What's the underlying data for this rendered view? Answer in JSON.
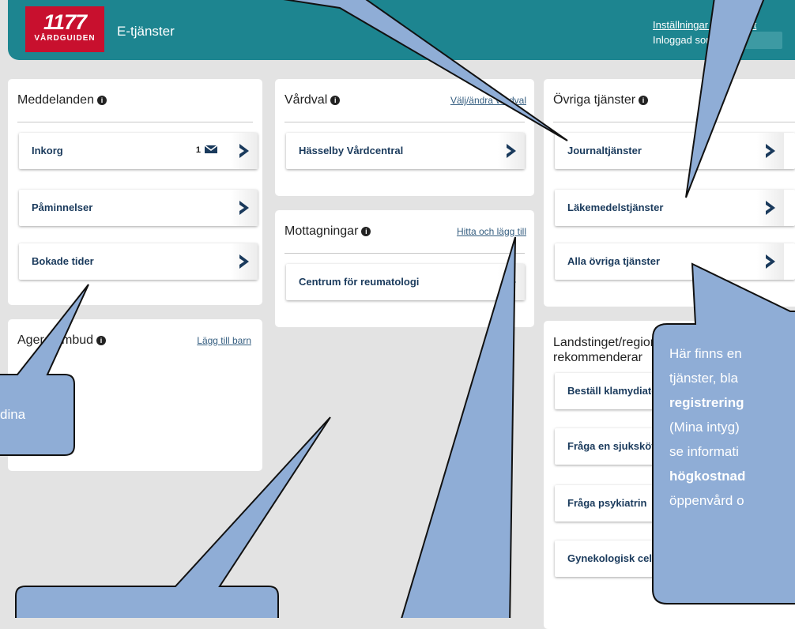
{
  "header": {
    "logo_number": "1177",
    "logo_text": "VÅRDGUIDEN",
    "title": "E-tjänster",
    "link": "Inställningar | Logga ut",
    "logged_in": "Inloggad som"
  },
  "cards": {
    "meddelanden": {
      "title": "Meddelanden",
      "items": [
        {
          "label": "Inkorg",
          "count": "1"
        },
        {
          "label": "Påminnelser"
        },
        {
          "label": "Bokade tider"
        }
      ]
    },
    "vardval": {
      "title": "Vårdval",
      "link": "Välj/ändra vårdval",
      "items": [
        {
          "label": "Hässelby Vårdcentral"
        }
      ]
    },
    "mottagningar": {
      "title": "Mottagningar",
      "link": "Hitta och lägg till",
      "items": [
        {
          "label": "Centrum för reumatologi"
        }
      ]
    },
    "ovriga": {
      "title": "Övriga tjänster",
      "items": [
        {
          "label": "Journaltjänster"
        },
        {
          "label": "Läkemedelstjänster"
        },
        {
          "label": "Alla övriga tjänster"
        }
      ]
    },
    "ombud": {
      "title": "Agera ombud",
      "link": "Lägg till barn"
    },
    "landsting": {
      "title_line1": "Landstinget/region",
      "title_line2": "rekommenderar",
      "items": [
        {
          "label": "Beställ klamydiatest"
        },
        {
          "label": "Fråga en sjuksköterska"
        },
        {
          "label": "Fråga psykiatrin"
        },
        {
          "label": "Gynekologisk cellprovtagning"
        }
      ]
    }
  },
  "callouts": {
    "left_text": "dina",
    "right_lines": [
      "Här finns en",
      "tjänster, bla",
      "registrering",
      "(Mina intyg)",
      "se informati",
      "högkostnad",
      "öppenvård o"
    ]
  },
  "colors": {
    "header": "#1d8590",
    "logo": "#c8102e",
    "callout": "#8fadd6",
    "link": "#1a3a5c"
  },
  "icons": [
    "envelope-icon",
    "chevron-right-icon",
    "info-icon"
  ]
}
